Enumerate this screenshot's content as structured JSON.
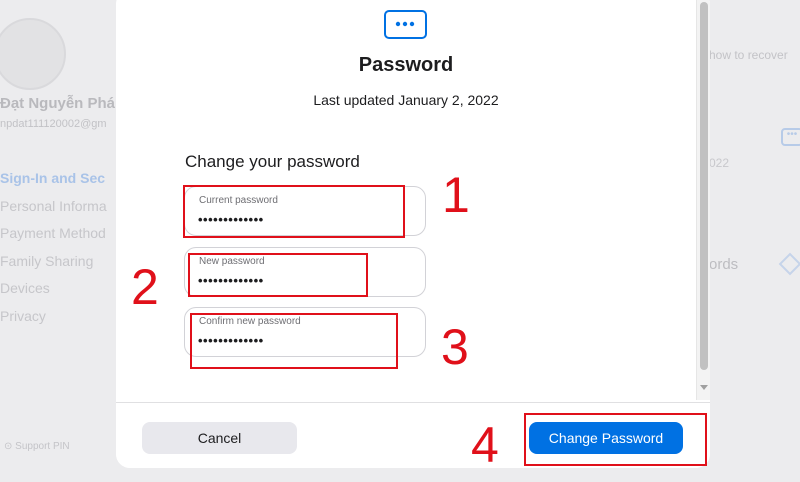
{
  "background": {
    "user_name": "Đạt Nguyễn Phá",
    "user_email": "npdat111120002@gm",
    "nav_items": [
      "Sign-In and Sec",
      "Personal Informa",
      "Payment Method",
      "Family Sharing",
      "Devices",
      "Privacy"
    ],
    "support_pin": "Support PIN",
    "right_hint": "how to recover",
    "right_year": "022",
    "right_label": "ords"
  },
  "modal": {
    "icon": "password-dots-icon",
    "title": "Password",
    "subtitle": "Last updated January 2, 2022",
    "section_heading": "Change your password",
    "fields": [
      {
        "label": "Current password",
        "value": "•••••••••••••"
      },
      {
        "label": "New password",
        "value": "•••••••••••••"
      },
      {
        "label": "Confirm new password",
        "value": "•••••••••••••"
      }
    ],
    "cancel_label": "Cancel",
    "change_label": "Change Password"
  },
  "annotations": {
    "color": "#e0101a",
    "numbers": [
      "1",
      "2",
      "3",
      "4"
    ]
  },
  "colors": {
    "accent": "#0071e3",
    "annotation_red": "#e0101a"
  }
}
